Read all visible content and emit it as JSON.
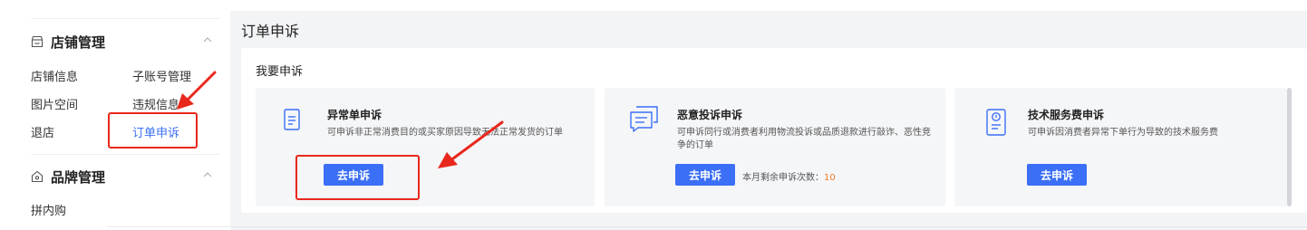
{
  "sidebar": {
    "sections": [
      {
        "title": "店铺管理",
        "icon": "store-icon",
        "items": [
          "店铺信息",
          "子账号管理",
          "图片空间",
          "违规信息",
          "退店",
          "订单申诉"
        ]
      },
      {
        "title": "品牌管理",
        "icon": "brand-icon",
        "items": [
          "拼内购"
        ]
      }
    ]
  },
  "page": {
    "title": "订单申诉",
    "section_title": "我要申诉"
  },
  "cards": [
    {
      "icon": "document-icon",
      "title": "异常单申诉",
      "desc": "可申诉非正常消费目的或买家原因导致无法正常发货的订单",
      "button": "去申诉"
    },
    {
      "icon": "complaint-chat-icon",
      "title": "恶意投诉申诉",
      "desc": "可申诉同行或消费者利用物流投诉或品质退款进行敲诈、恶性竞争的订单",
      "button": "去申诉",
      "remaining_label": "本月剩余申诉次数：",
      "remaining_count": "10"
    },
    {
      "icon": "service-fee-icon",
      "title": "技术服务费申诉",
      "desc": "可申诉因消费者异常下单行为导致的技术服务费",
      "button": "去申诉"
    }
  ],
  "colors": {
    "accent": "#3b6ff6",
    "annotation_red": "#e8281c",
    "count_orange": "#f27c2a"
  }
}
